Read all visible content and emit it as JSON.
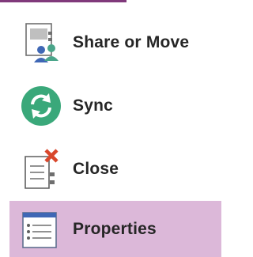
{
  "menu": {
    "items": [
      {
        "label": "Share or Move",
        "icon": "share-move-icon"
      },
      {
        "label": "Sync",
        "icon": "sync-icon"
      },
      {
        "label": "Close",
        "icon": "close-notebook-icon"
      },
      {
        "label": "Properties",
        "icon": "properties-icon",
        "selected": true
      }
    ]
  },
  "colors": {
    "accent": "#80397b",
    "selected_background": "#dcb8d9",
    "sync_green": "#3aa87a",
    "close_red": "#d9472b"
  }
}
